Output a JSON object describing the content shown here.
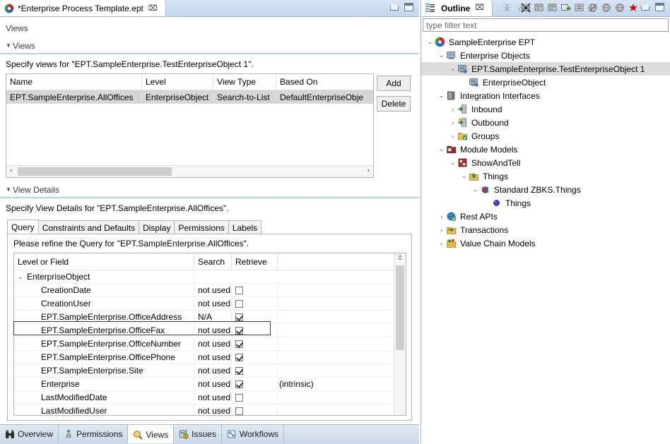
{
  "editor": {
    "tab": {
      "title": "*Enterprise Process Template.ept",
      "close_glyph": "⌧",
      "icon": "ept-logo-icon"
    },
    "window_buttons": {
      "minimize": "minimize-icon",
      "maximize": "maximize-icon"
    },
    "page_label": "Views",
    "views_section": {
      "header": "Views",
      "hint": "Specify views for \"EPT.SampleEnterprise.TestEnterpriseObject 1\".",
      "columns": [
        "Name",
        "Level",
        "View Type",
        "Based On"
      ],
      "rows": [
        [
          "EPT.SampleEnterprise.AllOffices",
          "EnterpriseObject",
          "Search-to-List",
          "DefaultEnterpriseObje"
        ]
      ],
      "buttons": {
        "add": "Add",
        "delete": "Delete"
      },
      "scroll_left_glyph": "‹",
      "scroll_right_glyph": "›"
    },
    "view_details_section": {
      "header": "View Details",
      "hint": "Specify View Details for \"EPT.SampleEnterprise.AllOffices\".",
      "tabs": [
        {
          "label": "Query",
          "active": true
        },
        {
          "label": "Constraints and Defaults",
          "active": false
        },
        {
          "label": "Display",
          "active": false
        },
        {
          "label": "Permissions",
          "active": false
        },
        {
          "label": "Labels",
          "active": false
        }
      ],
      "query_hint": "Please refine the Query for \"EPT.SampleEnterprise.AllOffices\".",
      "columns": [
        "Level or Field",
        "Search",
        "Retrieve",
        ""
      ],
      "rows": [
        {
          "indent": 0,
          "twisty": "⌄",
          "field": "EnterpriseObject",
          "search": "",
          "retrieve": "none",
          "note": "",
          "selected": false
        },
        {
          "indent": 1,
          "twisty": "",
          "field": "CreationDate",
          "search": "not used",
          "retrieve": "unchecked",
          "note": "",
          "selected": false
        },
        {
          "indent": 1,
          "twisty": "",
          "field": "CreationUser",
          "search": "not used",
          "retrieve": "unchecked",
          "note": "",
          "selected": false
        },
        {
          "indent": 1,
          "twisty": "",
          "field": "EPT.SampleEnterprise.OfficeAddress",
          "search": "N/A",
          "retrieve": "checked",
          "note": "",
          "selected": false
        },
        {
          "indent": 1,
          "twisty": "",
          "field": "EPT.SampleEnterprise.OfficeFax",
          "search": "not used",
          "retrieve": "checked",
          "note": "",
          "selected": true
        },
        {
          "indent": 1,
          "twisty": "",
          "field": "EPT.SampleEnterprise.OfficeNumber",
          "search": "not used",
          "retrieve": "checked",
          "note": "",
          "selected": false
        },
        {
          "indent": 1,
          "twisty": "",
          "field": "EPT.SampleEnterprise.OfficePhone",
          "search": "not used",
          "retrieve": "checked",
          "note": "",
          "selected": false
        },
        {
          "indent": 1,
          "twisty": "",
          "field": "EPT.SampleEnterprise.Site",
          "search": "not used",
          "retrieve": "checked",
          "note": "",
          "selected": false
        },
        {
          "indent": 1,
          "twisty": "",
          "field": "Enterprise",
          "search": "not used",
          "retrieve": "checked",
          "note": "(intrinsic)",
          "selected": false
        },
        {
          "indent": 1,
          "twisty": "",
          "field": "LastModifiedDate",
          "search": "not used",
          "retrieve": "unchecked",
          "note": "",
          "selected": false
        },
        {
          "indent": 1,
          "twisty": "",
          "field": "LastModifiedUser",
          "search": "not used",
          "retrieve": "unchecked",
          "note": "",
          "selected": false
        }
      ],
      "scroll_up_glyph": "⌃",
      "scroll_down_glyph": "⌄"
    },
    "page_tabs": [
      {
        "label": "Overview",
        "icon": "binoculars-icon",
        "active": false
      },
      {
        "label": "Permissions",
        "icon": "person-key-icon",
        "active": false
      },
      {
        "label": "Views",
        "icon": "magnifier-icon",
        "active": true
      },
      {
        "label": "Issues",
        "icon": "issues-icon",
        "active": false
      },
      {
        "label": "Workflows",
        "icon": "workflows-icon",
        "active": false
      }
    ]
  },
  "outline": {
    "tabs": [
      {
        "label": "Outline",
        "active": true,
        "icon": "outline-icon",
        "close_glyph": "⌧"
      },
      {
        "label": "Ant",
        "active": false,
        "icon": "ant-icon"
      }
    ],
    "toolbar": [
      "collapse-all-icon",
      "sort-a-icon",
      "sort-b-icon",
      "link-editor-icon",
      "filters-icon",
      "globe-slash-icon",
      "globe-a-icon",
      "globe-b-icon",
      "delete-red-icon"
    ],
    "window_buttons": {
      "minimize": "minimize-icon",
      "maximize": "maximize-icon"
    },
    "filter_placeholder": "type filter text",
    "tree": [
      {
        "indent": 0,
        "arrow": "⌄",
        "icon": "ept-logo-icon",
        "label": "SampleEnterprise EPT",
        "selected": false
      },
      {
        "indent": 1,
        "arrow": "⌄",
        "icon": "enterprise-objects-icon",
        "label": "Enterprise Objects",
        "selected": false
      },
      {
        "indent": 2,
        "arrow": "⌄",
        "icon": "object-icon",
        "label": "EPT.SampleEnterprise.TestEnterpriseObject 1",
        "selected": true
      },
      {
        "indent": 3,
        "arrow": "",
        "icon": "object-icon",
        "label": "EnterpriseObject",
        "selected": false
      },
      {
        "indent": 1,
        "arrow": "⌄",
        "icon": "integration-icon",
        "label": "Integration Interfaces",
        "selected": false
      },
      {
        "indent": 2,
        "arrow": "›",
        "icon": "inbound-icon",
        "label": "Inbound",
        "selected": false
      },
      {
        "indent": 2,
        "arrow": "›",
        "icon": "outbound-icon",
        "label": "Outbound",
        "selected": false
      },
      {
        "indent": 2,
        "arrow": "›",
        "icon": "groups-icon",
        "label": "Groups",
        "selected": false
      },
      {
        "indent": 1,
        "arrow": "⌄",
        "icon": "module-models-icon",
        "label": "Module Models",
        "selected": false
      },
      {
        "indent": 2,
        "arrow": "⌄",
        "icon": "showandtell-icon",
        "label": "ShowAndTell",
        "selected": false
      },
      {
        "indent": 3,
        "arrow": "⌄",
        "icon": "things-icon",
        "label": "Things",
        "selected": false
      },
      {
        "indent": 4,
        "arrow": "⌄",
        "icon": "standard-icon",
        "label": "Standard ZBKS.Things",
        "selected": false
      },
      {
        "indent": 5,
        "arrow": "",
        "icon": "sphere-icon",
        "label": "Things",
        "selected": false
      },
      {
        "indent": 1,
        "arrow": "›",
        "icon": "rest-api-icon",
        "label": "Rest APIs",
        "selected": false
      },
      {
        "indent": 1,
        "arrow": "›",
        "icon": "transactions-icon",
        "label": "Transactions",
        "selected": false
      },
      {
        "indent": 1,
        "arrow": "›",
        "icon": "value-chain-icon",
        "label": "Value Chain Models",
        "selected": false
      }
    ]
  },
  "colors": {
    "tab_gradient_top": "#d7e5f5",
    "tab_gradient_bottom": "#c2d7ee",
    "selection": "#d6d6d6",
    "section_rule": "#b9d0e6",
    "accent_red": "#cc0000",
    "accent_green": "#3a8f3a"
  }
}
